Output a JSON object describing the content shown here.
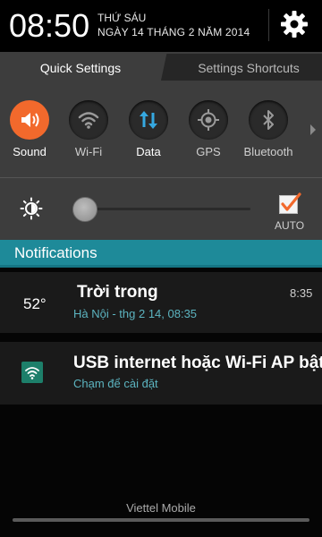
{
  "header": {
    "clock": "08:50",
    "day_name": "THỨ SÁU",
    "date": "NGÀY 14 THÁNG 2 NĂM 2014",
    "settings_icon": "gear-icon"
  },
  "tabs": [
    {
      "label": "Quick Settings",
      "active": true
    },
    {
      "label": "Settings Shortcuts",
      "active": false
    }
  ],
  "quick_settings": [
    {
      "label": "Sound",
      "icon": "sound-icon",
      "active": true
    },
    {
      "label": "Wi-Fi",
      "icon": "wifi-icon",
      "active": false
    },
    {
      "label": "Data",
      "icon": "data-icon",
      "active": false
    },
    {
      "label": "GPS",
      "icon": "gps-icon",
      "active": false
    },
    {
      "label": "Bluetooth",
      "icon": "bluetooth-icon",
      "active": false
    }
  ],
  "brightness": {
    "auto_label": "AUTO",
    "auto_checked": true,
    "level": 0.0
  },
  "notifications": {
    "title": "Notifications",
    "items": [
      {
        "badge": "52°",
        "title": "Trời trong",
        "subtitle": "Hà Nội - thg 2 14, 08:35",
        "time": "8:35"
      },
      {
        "icon": "wifi-icon",
        "title": "USB internet hoặc Wi-Fi AP bật",
        "subtitle": "Chạm để cài đặt"
      }
    ]
  },
  "footer": {
    "carrier": "Viettel Mobile"
  },
  "colors": {
    "accent_orange": "#f2692c",
    "accent_teal": "#1e8a99",
    "panel_gray": "#3d3d3d"
  }
}
